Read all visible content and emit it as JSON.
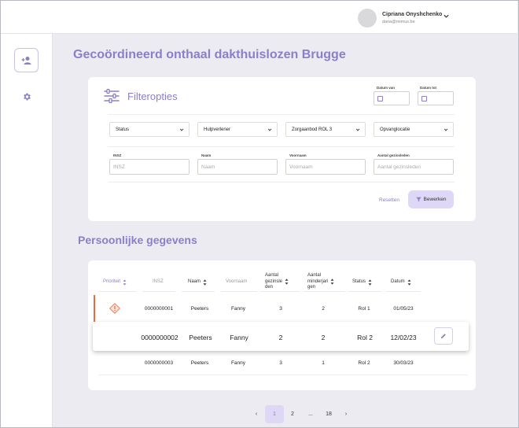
{
  "user": {
    "name": "Cipriana Onyshchenko",
    "email": "daria@mimus.be"
  },
  "page": {
    "title": "Gecoördineerd onthaal dakthuislozen Brugge"
  },
  "filters": {
    "title": "Filteropties",
    "date_from_label": "Datum van",
    "date_to_label": "Datum tot",
    "selects": [
      "Status",
      "Hulpverlener",
      "Zorgaanbod ROL 3",
      "Opvanglocatie"
    ],
    "fields": [
      {
        "label": "INSZ",
        "placeholder": "INSZ"
      },
      {
        "label": "Naam",
        "placeholder": "Naam"
      },
      {
        "label": "Voornaam",
        "placeholder": "Voornaam"
      },
      {
        "label": "Aantal gezinsleden",
        "placeholder": "Aantal gezinsleden"
      }
    ],
    "reset_label": "Resetten",
    "edit_label": "Bewerken"
  },
  "personal": {
    "title": "Persoonlijke gegevens",
    "headers": {
      "priority": "Prioriteit",
      "insz": "INSZ",
      "naam": "Naam",
      "voornaam": "Voornaam",
      "gezin_1": "Aantal",
      "gezin_2": "gezinsle",
      "gezin_3": "den",
      "minder_1": "Aantal",
      "minder_2": "minderjari",
      "minder_3": "gen",
      "status": "Status",
      "datum": "Datum"
    },
    "rows": [
      {
        "insz": "0000000001",
        "naam": "Peeters",
        "voornaam": "Fanny",
        "gezin": "3",
        "minder": "2",
        "status": "Rol 1",
        "datum": "01/05/23"
      },
      {
        "insz": "0000000002",
        "naam": "Peeters",
        "voornaam": "Fanny",
        "gezin": "2",
        "minder": "2",
        "status": "Rol 2",
        "datum": "12/02/23"
      },
      {
        "insz": "0000000003",
        "naam": "Peeters",
        "voornaam": "Fanny",
        "gezin": "3",
        "minder": "1",
        "status": "Rol 2",
        "datum": "30/03/23"
      }
    ]
  },
  "pagination": {
    "prev": "‹",
    "pages": [
      "1",
      "2",
      "...",
      "18"
    ],
    "next": "›",
    "current": "1"
  },
  "colors": {
    "accent": "#8d7ec9",
    "accent_soft": "#ded7f5",
    "priority": "#e96b43"
  },
  "icons": [
    "chevron-down-icon",
    "add-user-icon",
    "gear-icon",
    "sliders-icon",
    "calendar-icon",
    "filter-icon",
    "warning-icon",
    "pencil-icon",
    "sort-icon"
  ]
}
